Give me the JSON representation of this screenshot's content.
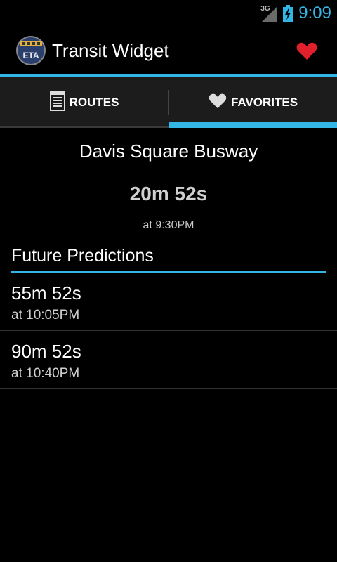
{
  "status_bar": {
    "network": "3G",
    "time": "9:09"
  },
  "action_bar": {
    "app_icon_label": "ETA",
    "title": "Transit Widget",
    "favorite_icon": "heart-icon",
    "accent_color": "#33b5e5"
  },
  "tabs": [
    {
      "label": "ROUTES",
      "icon": "list-icon",
      "selected": false
    },
    {
      "label": "FAVORITES",
      "icon": "heart-icon",
      "selected": true
    }
  ],
  "stop": {
    "name": "Davis Square Busway",
    "eta": "20m 52s",
    "arrival": "at 9:30PM"
  },
  "future": {
    "title": "Future Predictions",
    "items": [
      {
        "eta": "55m 52s",
        "arrival": "at 10:05PM"
      },
      {
        "eta": "90m 52s",
        "arrival": "at 10:40PM"
      }
    ]
  }
}
